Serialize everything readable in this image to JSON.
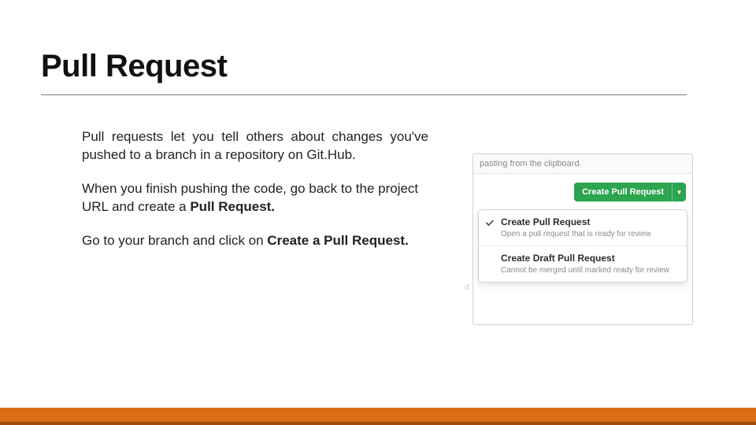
{
  "title": "Pull Request",
  "paragraphs": {
    "p1": "Pull requests let you tell others about changes you've pushed to a branch in a repository on Git.Hub.",
    "p2a": "When you finish pushing the code, go back to the project URL and create a ",
    "p2b": "Pull Request.",
    "p3a": "Go to your branch and click on ",
    "p3b": "Create a Pull Request."
  },
  "screenshot": {
    "clipboard_hint": "pasting from the clipboard.",
    "button_label": "Create Pull Request",
    "caret": "▼",
    "option1": {
      "title": "Create Pull Request",
      "desc": "Open a pull request that is ready for review"
    },
    "option2": {
      "title": "Create Draft Pull Request",
      "desc": "Cannot be merged until marked ready for review"
    },
    "left_faint": "d"
  }
}
